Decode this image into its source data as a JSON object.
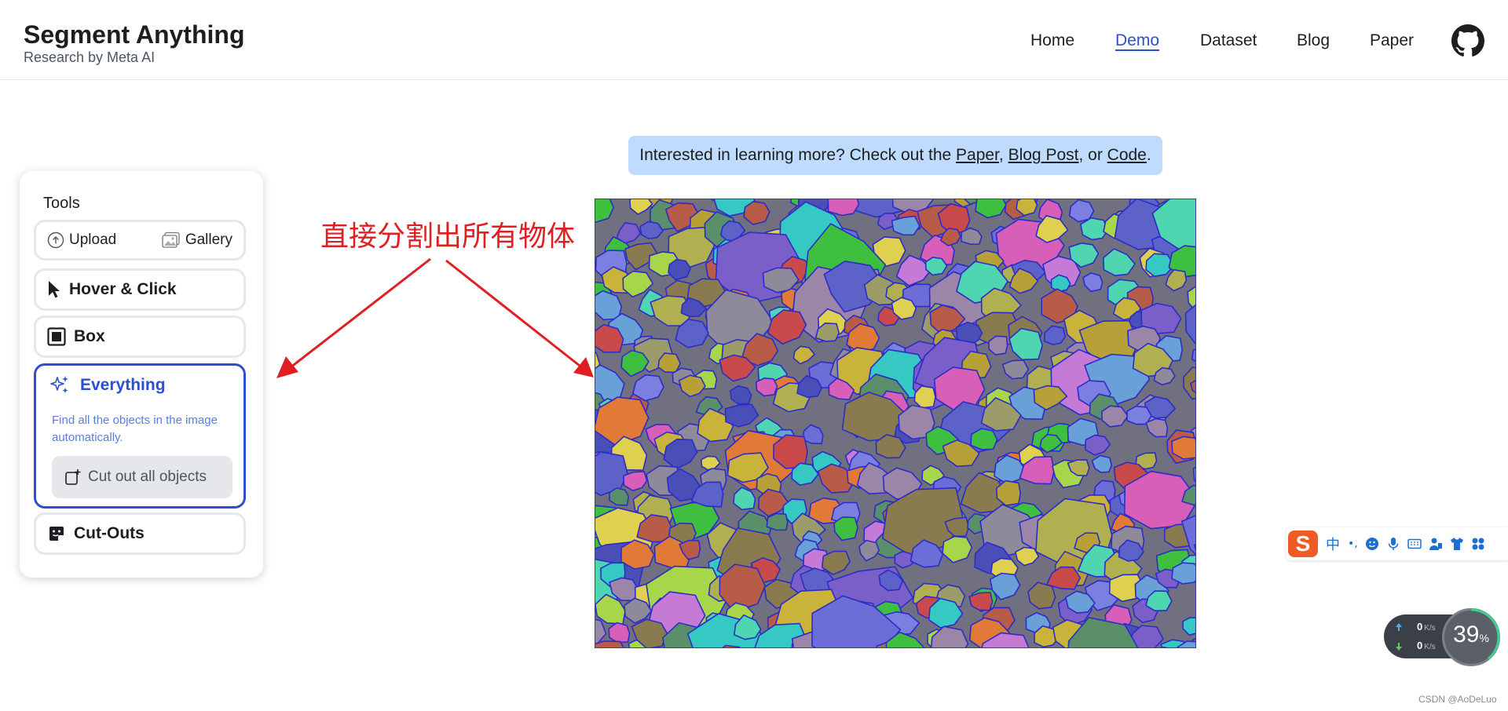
{
  "header": {
    "title": "Segment Anything",
    "subtitle": "Research by Meta AI",
    "nav": [
      "Home",
      "Demo",
      "Dataset",
      "Blog",
      "Paper"
    ],
    "active_nav": "Demo"
  },
  "tools": {
    "title": "Tools",
    "upload": "Upload",
    "gallery": "Gallery",
    "hover_click": "Hover & Click",
    "box": "Box",
    "everything": {
      "label": "Everything",
      "description": "Find all the objects in the image automatically.",
      "cut_button": "Cut out all objects"
    },
    "cutouts": "Cut-Outs"
  },
  "annotation": "直接分割出所有物体",
  "banner": {
    "prefix": "Interested in learning more? Check out the ",
    "paper": "Paper",
    "sep1": ", ",
    "blog": "Blog Post",
    "sep2": ", or ",
    "code": "Code",
    "suffix": "."
  },
  "ime": {
    "logo": "S",
    "mode": "中",
    "punct": "•,"
  },
  "netspeed": {
    "up": "0",
    "down": "0",
    "unit": "K/s",
    "percent": "39",
    "percent_sign": "%"
  },
  "watermark": "CSDN @AoDeLuo",
  "colors": {
    "accent": "#2b4fcf",
    "annotation": "#e01f22",
    "banner_bg": "#bfdbfe",
    "ime_logo": "#ef5b25"
  }
}
